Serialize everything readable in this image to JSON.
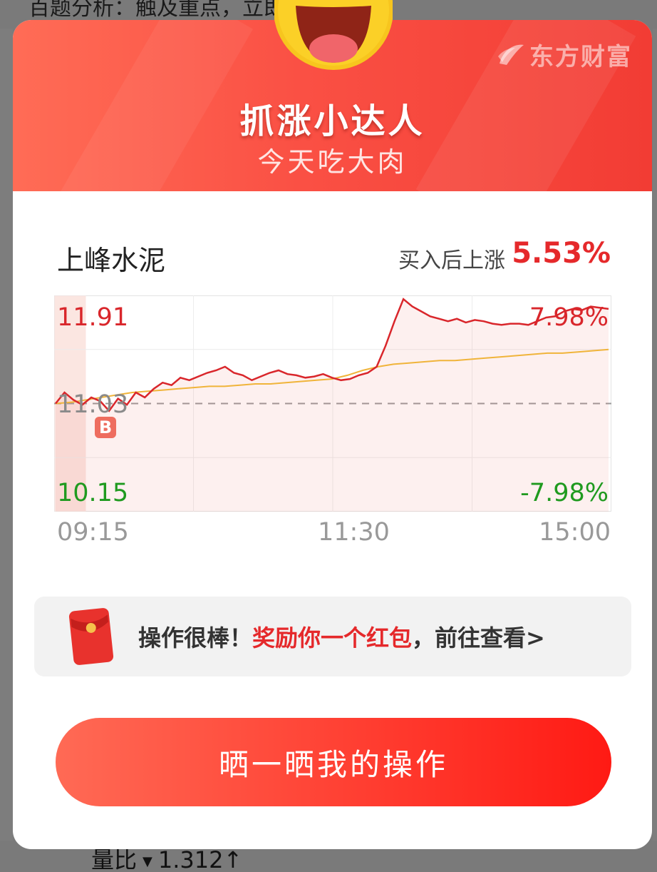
{
  "background": {
    "top_text": "百题分析：触及重点，立即点击查看",
    "ratio_label": "量比",
    "ratio_value": "1.312↑",
    "dropdown_icon": "triangle-down-icon"
  },
  "modal": {
    "brand": "东方财富",
    "title": "抓涨小达人",
    "subtitle": "今天吃大肉",
    "emoji_icon": "laughing-face-icon"
  },
  "stock": {
    "name": "上峰水泥",
    "gain_label": "买入后上涨",
    "gain_value": "5.53%"
  },
  "chart_data": {
    "type": "line",
    "y_max_label": "11.91",
    "y_max_pct": "7.98%",
    "y_base_label": "11.03",
    "y_min_label": "10.15",
    "y_min_pct": "-7.98%",
    "x_labels": [
      "09:15",
      "11:30",
      "15:00"
    ],
    "ylim": [
      10.15,
      11.91
    ],
    "base_price": 11.03,
    "buy_marker": "B",
    "grid": true,
    "series": [
      {
        "values": [
          11.03,
          11.12,
          11.06,
          11.02,
          11.08,
          11.05,
          10.97,
          11.07,
          11.02,
          11.12,
          11.08,
          11.15,
          11.2,
          11.18,
          11.24,
          11.22,
          11.25,
          11.28,
          11.3,
          11.33,
          11.28,
          11.26,
          11.22,
          11.25,
          11.28,
          11.3,
          11.27,
          11.26,
          11.24,
          11.25,
          11.27,
          11.24,
          11.22,
          11.23,
          11.26,
          11.28,
          11.33,
          11.5,
          11.7,
          11.88,
          11.82,
          11.78,
          11.74,
          11.72,
          11.7,
          11.72,
          11.69,
          11.71,
          11.7,
          11.68,
          11.67,
          11.68,
          11.68,
          11.67,
          11.7,
          11.73,
          11.74,
          11.78,
          11.8,
          11.79,
          11.82,
          11.81,
          11.8
        ],
        "color": "#d9262b"
      },
      {
        "values": [
          11.03,
          11.04,
          11.06,
          11.08,
          11.1,
          11.12,
          11.13,
          11.14,
          11.15,
          11.16,
          11.17,
          11.17,
          11.18,
          11.19,
          11.19,
          11.2,
          11.21,
          11.22,
          11.23,
          11.26,
          11.3,
          11.33,
          11.35,
          11.36,
          11.37,
          11.38,
          11.38,
          11.39,
          11.4,
          11.41,
          11.42,
          11.43,
          11.44,
          11.44,
          11.45,
          11.46,
          11.47
        ],
        "color": "#f0b43a"
      }
    ]
  },
  "reward": {
    "envelope_icon": "red-envelope-icon",
    "prefix": "操作很棒！",
    "highlight": "奖励你一个红包",
    "suffix": "，前往查看>"
  },
  "share_button": "晒一晒我的操作"
}
